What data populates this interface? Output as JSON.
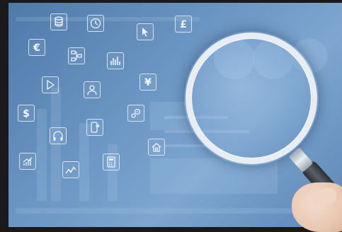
{
  "scene": {
    "description_tag": "magnifying-glass-over-finance-icons",
    "palette": {
      "background": "#5f8ab8",
      "icon_line": "#eef4ff",
      "frame": "#1a1a1a",
      "lens_rim": "#e7edf3",
      "handle": "#3a3f45",
      "skin": "#edcdb8"
    }
  },
  "icons": [
    {
      "name": "coins-stack-icon",
      "glyph": ""
    },
    {
      "name": "clock-icon",
      "glyph": ""
    },
    {
      "name": "cursor-arrow-icon",
      "glyph": ""
    },
    {
      "name": "pound-icon",
      "glyph": "£"
    },
    {
      "name": "euro-icon",
      "glyph": "€"
    },
    {
      "name": "flowchart-icon",
      "glyph": ""
    },
    {
      "name": "bar-chart-icon",
      "glyph": ""
    },
    {
      "name": "play-icon",
      "glyph": ""
    },
    {
      "name": "user-icon",
      "glyph": ""
    },
    {
      "name": "yen-icon",
      "glyph": "¥"
    },
    {
      "name": "dollar-icon",
      "glyph": "$"
    },
    {
      "name": "gears-icon",
      "glyph": ""
    },
    {
      "name": "headphones-icon",
      "glyph": ""
    },
    {
      "name": "mobile-transfer-icon",
      "glyph": ""
    },
    {
      "name": "home-icon",
      "glyph": ""
    },
    {
      "name": "growth-chart-icon",
      "glyph": ""
    },
    {
      "name": "line-chart-icon",
      "glyph": ""
    },
    {
      "name": "calculator-icon",
      "glyph": ""
    }
  ]
}
